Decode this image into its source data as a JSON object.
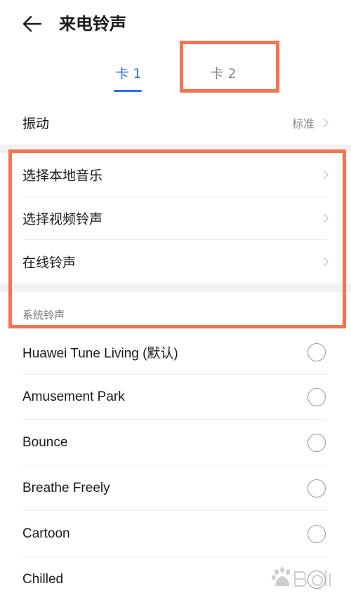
{
  "header": {
    "title": "来电铃声"
  },
  "tabs": [
    {
      "label": "卡 1",
      "selected": true
    },
    {
      "label": "卡 2",
      "selected": false
    }
  ],
  "vibration": {
    "label": "振动",
    "value": "标准"
  },
  "menu": [
    {
      "label": "选择本地音乐"
    },
    {
      "label": "选择视频铃声"
    },
    {
      "label": "在线铃声"
    }
  ],
  "system_section": {
    "title": "系统铃声"
  },
  "ringtones": [
    {
      "label": "Huawei Tune Living (默认)"
    },
    {
      "label": "Amusement Park"
    },
    {
      "label": "Bounce"
    },
    {
      "label": "Breathe Freely"
    },
    {
      "label": "Cartoon"
    },
    {
      "label": "Chilled"
    }
  ],
  "colors": {
    "accent": "#256fff",
    "highlight": "#f5734f"
  }
}
